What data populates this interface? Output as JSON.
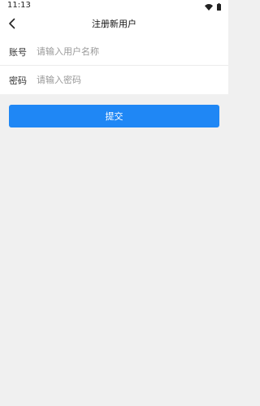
{
  "status_bar": {
    "time": "11:13",
    "icons": [
      "wifi-icon",
      "battery-icon"
    ]
  },
  "header": {
    "title": "注册新用户",
    "back_icon": "chevron-left-icon"
  },
  "form": {
    "account": {
      "label": "账号",
      "placeholder": "请输入用户名称",
      "value": ""
    },
    "password": {
      "label": "密码",
      "placeholder": "请输入密码",
      "value": ""
    }
  },
  "submit": {
    "label": "提交"
  },
  "colors": {
    "accent": "#1f87f5",
    "background": "#f0f0f0",
    "surface": "#ffffff",
    "placeholder": "#999999"
  }
}
